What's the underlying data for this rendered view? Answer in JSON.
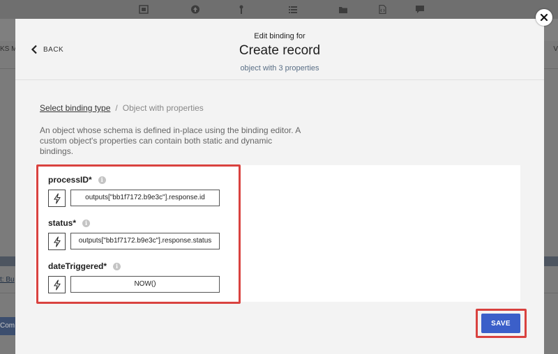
{
  "background": {
    "left_tab_fragment": "KS M",
    "right_tab_fragment": "V",
    "link_fragment": "t: Bu",
    "button_fragment": "Com"
  },
  "modal": {
    "back_label": "BACK",
    "overline": "Edit binding for",
    "title": "Create record",
    "subtitle": "object with 3 properties",
    "breadcrumb": {
      "link": "Select binding type",
      "separator": "/",
      "current": "Object with properties"
    },
    "description": "An object whose schema is defined in-place using the binding editor. A custom object's properties can contain both static and dynamic bindings.",
    "fields": [
      {
        "label": "processID*",
        "value": "outputs[\"bb1f7172.b9e3c\"].response.id"
      },
      {
        "label": "status*",
        "value": "outputs[\"bb1f7172.b9e3c\"].response.status"
      },
      {
        "label": "dateTriggered*",
        "value": "NOW()"
      }
    ],
    "save_label": "SAVE"
  },
  "icons": {
    "back": "chevron-left-icon",
    "info": "info-icon",
    "dynamic": "lightning-bolt-icon",
    "close": "close-icon"
  },
  "colors": {
    "primary": "#3b5fc9",
    "highlight": "#d9423f",
    "subtitle": "#5a6f86"
  }
}
